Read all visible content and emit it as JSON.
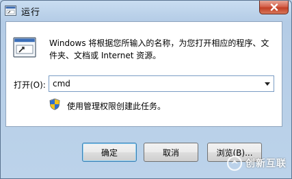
{
  "window": {
    "title": "运行",
    "close_icon": "close-icon"
  },
  "content": {
    "description": "Windows 将根据您所输入的名称，为您打开相应的程序、文件夹、文档或 Internet 资源。",
    "open_label": "打开(O):",
    "command_value": "cmd",
    "admin_note": "使用管理权限创建此任务。"
  },
  "buttons": {
    "ok": "确定",
    "cancel": "取消",
    "browse": "浏览(B)..."
  },
  "watermark": {
    "text": "创新互联"
  },
  "colors": {
    "title_bar": "#b9d1ea",
    "close_button": "#c94a30",
    "client_bg": "#ffffff"
  }
}
